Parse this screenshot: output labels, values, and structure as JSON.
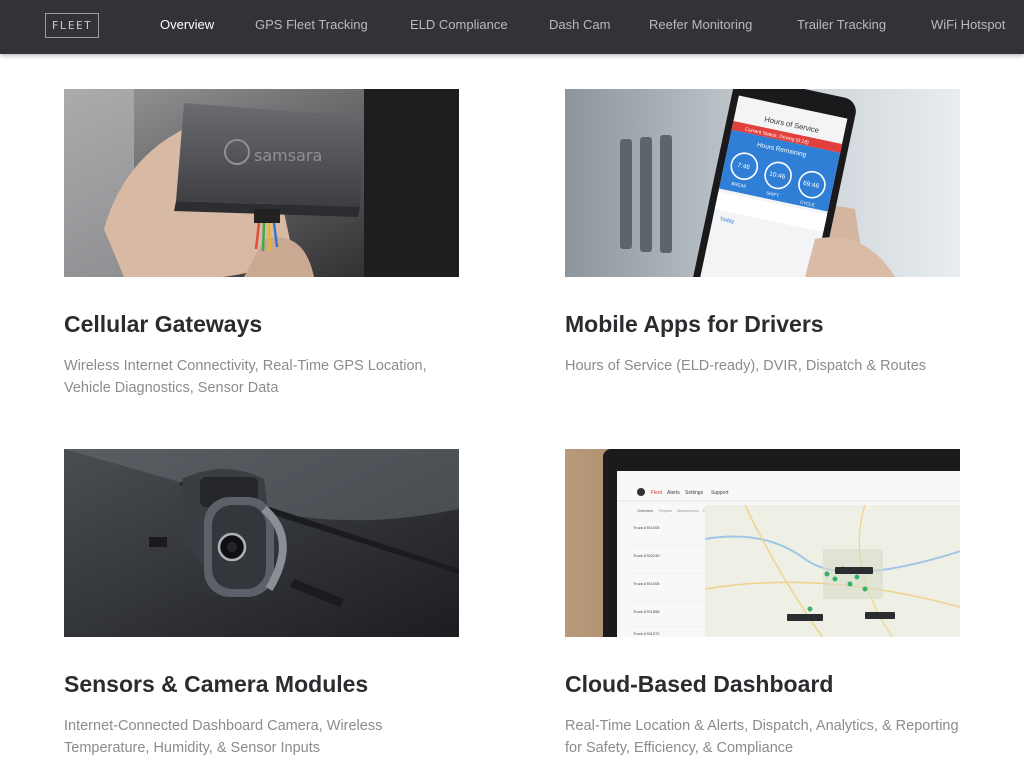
{
  "nav": {
    "logo": "FLEET",
    "links": [
      {
        "label": "Overview",
        "active": true
      },
      {
        "label": "GPS Fleet Tracking"
      },
      {
        "label": "ELD Compliance"
      },
      {
        "label": "Dash Cam"
      },
      {
        "label": "Reefer Monitoring"
      },
      {
        "label": "Trailer Tracking"
      },
      {
        "label": "WiFi Hotspot"
      }
    ]
  },
  "cards": [
    {
      "title": "Cellular Gateways",
      "description": "Wireless Internet Connectivity, Real-Time GPS Location, Vehicle Diagnostics, Sensor Data",
      "image_text": "samsara"
    },
    {
      "title": "Mobile Apps for Drivers",
      "description": "Hours of Service (ELD-ready), DVIR, Dispatch & Routes",
      "image_text": {
        "header": "Hours of Service",
        "status": "Current Status: Driving (0:18)",
        "remaining": "Hours Remaining",
        "dials": [
          {
            "value": "7:46",
            "label": "BREAK"
          },
          {
            "value": "10:46",
            "label": "SHIFT"
          },
          {
            "value": "69:46",
            "label": "CYCLE"
          }
        ],
        "footer": "Today"
      }
    },
    {
      "title": "Sensors & Camera Modules",
      "description": "Internet-Connected Dashboard Camera, Wireless Temperature, Humidity, & Sensor Inputs"
    },
    {
      "title": "Cloud-Based Dashboard",
      "description": "Real-Time Location & Alerts, Dispatch, Analytics, & Reporting for Safety, Efficiency, & Compliance",
      "image_text": {
        "tabs": [
          "Fleet",
          "Alerts",
          "Settings",
          "Support"
        ],
        "subtabs": [
          "Overview",
          "Reports",
          "Maintenance",
          "Dispatch"
        ],
        "trucks": [
          "Truck #761005",
          "Truck #762249",
          "Truck #761008",
          "Truck #761558",
          "Truck #761072"
        ]
      }
    }
  ],
  "colors": {
    "nav_bg": "#333337",
    "title": "#2c2c30",
    "description": "#8b8b90",
    "app_accent": "#e2403c",
    "app_blue": "#2f7fd6"
  }
}
